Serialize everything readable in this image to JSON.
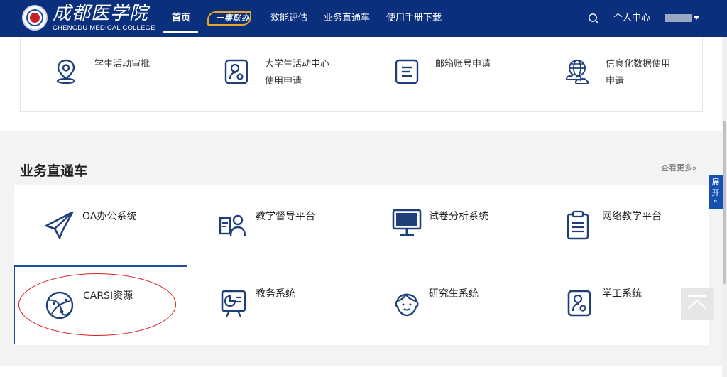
{
  "header": {
    "logo_cn": "成都医学院",
    "logo_en": "CHENGDU MEDICAL COLLEGE",
    "nav": [
      "首页",
      "一事联办",
      "效能评估",
      "业务直通车",
      "使用手册下载"
    ],
    "user_center": "个人中心"
  },
  "top_apps": [
    {
      "label_line1": "学生活动审批",
      "label_line2": "",
      "icon": "location-pin-icon"
    },
    {
      "label_line1": "大学生活动中心",
      "label_line2": "使用申请",
      "icon": "person-card-icon"
    },
    {
      "label_line1": "邮箱账号申请",
      "label_line2": "",
      "icon": "document-list-icon"
    },
    {
      "label_line1": "信息化数据使用",
      "label_line2": "申请",
      "icon": "globe-cloud-icon"
    }
  ],
  "section": {
    "title": "业务直通车",
    "more": "查看更多»"
  },
  "services": [
    {
      "label": "OA办公系统",
      "icon": "paper-plane-icon"
    },
    {
      "label": "教学督导平台",
      "icon": "supervision-icon"
    },
    {
      "label": "试卷分析系统",
      "icon": "monitor-icon"
    },
    {
      "label": "网络教学平台",
      "icon": "clipboard-icon"
    },
    {
      "label": "CARSI资源",
      "icon": "network-globe-icon"
    },
    {
      "label": "教务系统",
      "icon": "presentation-chart-icon"
    },
    {
      "label": "研究生系统",
      "icon": "graduate-face-icon"
    },
    {
      "label": "学工系统",
      "icon": "person-badge-icon"
    }
  ],
  "side": {
    "expand_char1": "展",
    "expand_char2": "开",
    "expand_arrow": "«"
  },
  "colors": {
    "header_bg": "#0a2f7c",
    "accent": "#1e4d9b",
    "highlight_ring": "#d8221f"
  }
}
